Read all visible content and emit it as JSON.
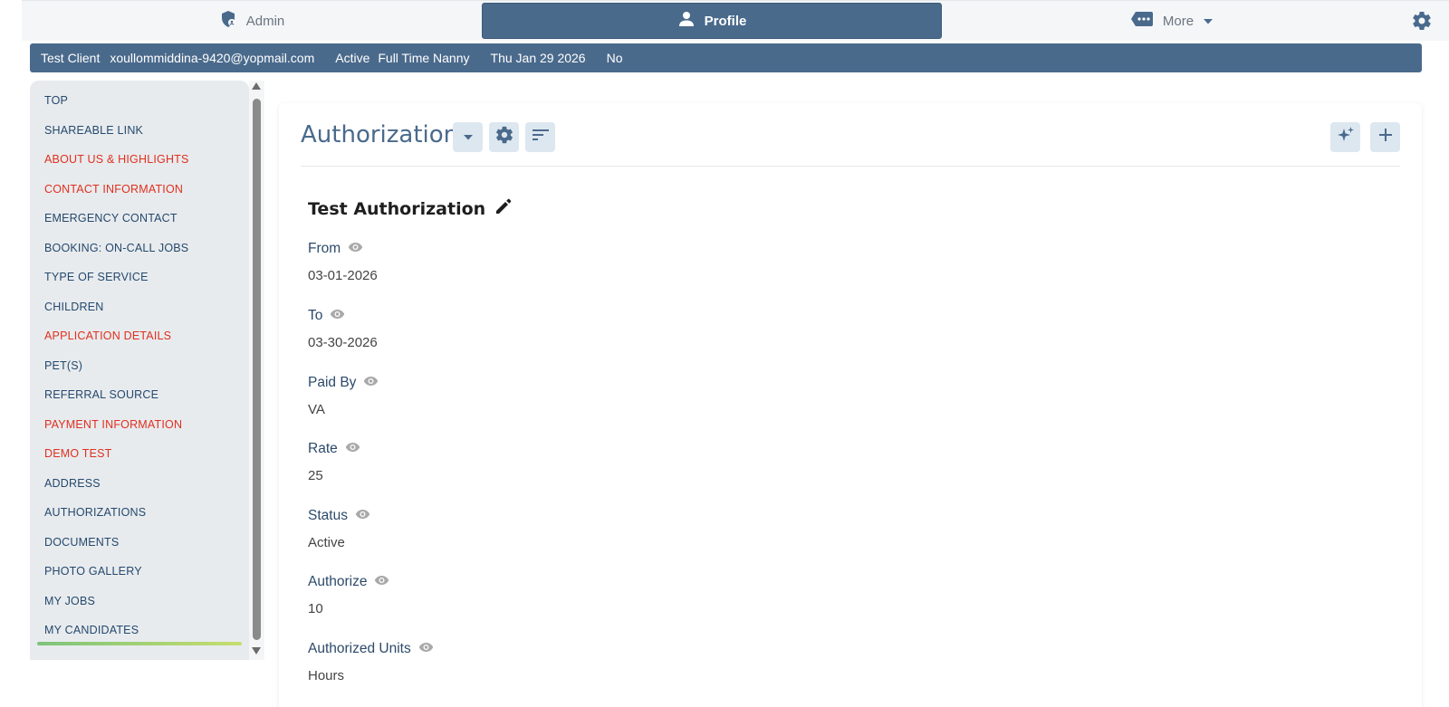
{
  "nav": {
    "admin_label": "Admin",
    "profile_label": "Profile",
    "more_label": "More"
  },
  "client": {
    "name": "Test Client",
    "email": "xoullommiddina-9420@yopmail.com",
    "status": "Active",
    "service": "Full Time Nanny",
    "date": "Thu Jan 29 2026",
    "flag": "No"
  },
  "sidebar": {
    "items": [
      {
        "label": "TOP",
        "color": "#24496d"
      },
      {
        "label": "SHAREABLE LINK",
        "color": "#24496d"
      },
      {
        "label": "ABOUT US & HIGHLIGHTS",
        "color": "#e0301e"
      },
      {
        "label": "CONTACT INFORMATION",
        "color": "#e0301e"
      },
      {
        "label": "EMERGENCY CONTACT",
        "color": "#24496d"
      },
      {
        "label": "BOOKING: ON-CALL JOBS",
        "color": "#24496d"
      },
      {
        "label": "TYPE OF SERVICE",
        "color": "#24496d"
      },
      {
        "label": "CHILDREN",
        "color": "#24496d"
      },
      {
        "label": "APPLICATION DETAILS",
        "color": "#e0301e"
      },
      {
        "label": "PET(S)",
        "color": "#24496d"
      },
      {
        "label": "REFERRAL SOURCE",
        "color": "#24496d"
      },
      {
        "label": "PAYMENT INFORMATION",
        "color": "#e0301e"
      },
      {
        "label": "DEMO TEST",
        "color": "#e0301e"
      },
      {
        "label": "ADDRESS",
        "color": "#24496d"
      },
      {
        "label": "AUTHORIZATIONS",
        "color": "#24496d"
      },
      {
        "label": "DOCUMENTS",
        "color": "#24496d"
      },
      {
        "label": "PHOTO GALLERY",
        "color": "#24496d"
      },
      {
        "label": "MY JOBS",
        "color": "#24496d"
      },
      {
        "label": "MY CANDIDATES",
        "color": "#24496d"
      }
    ]
  },
  "section": {
    "title": "Authorizations",
    "record_title": "Test Authorization",
    "fields": [
      {
        "label": "From",
        "value": "03-01-2026"
      },
      {
        "label": "To",
        "value": "03-30-2026"
      },
      {
        "label": "Paid By",
        "value": "VA"
      },
      {
        "label": "Rate",
        "value": "25"
      },
      {
        "label": "Status",
        "value": "Active"
      },
      {
        "label": "Authorize",
        "value": "10"
      },
      {
        "label": "Authorized Units",
        "value": "Hours"
      }
    ]
  },
  "icons": {
    "admin": "shield-user-icon",
    "profile": "person-icon",
    "more": "tag-dots-icon",
    "settings": "gear-icon",
    "dropdown": "caret-down-icon",
    "sort": "sort-lines-icon",
    "ai": "sparkle-icon",
    "add": "plus-icon",
    "edit": "pencil-icon",
    "visibility": "eye-icon"
  },
  "colors": {
    "primary": "#4a6a8c",
    "link": "#24496d",
    "warning": "#e0301e"
  }
}
